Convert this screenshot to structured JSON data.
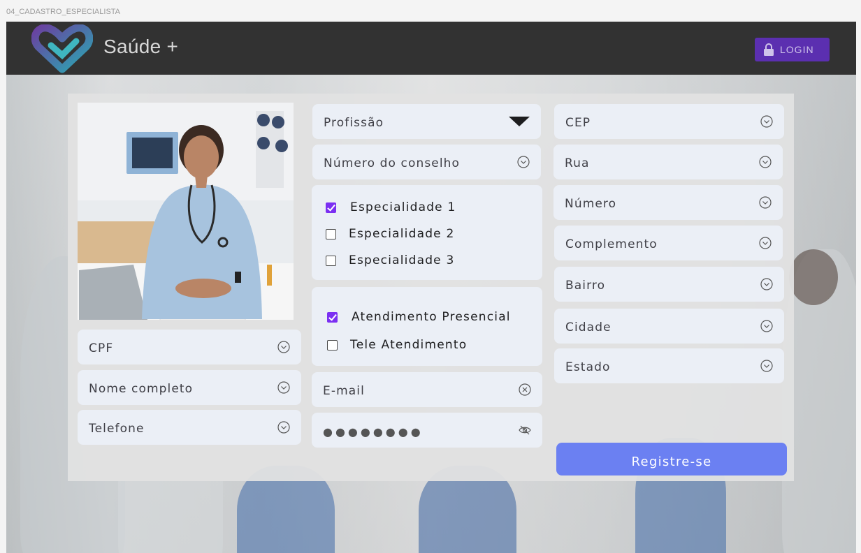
{
  "frame_label": "04_CADASTRO_ESPECIALISTA",
  "header": {
    "brand": "Saúde +",
    "login_label": "LOGIN"
  },
  "colors": {
    "topbar": "#323232",
    "accent_purple": "#5b2fb0",
    "checkbox_checked": "#7b2ff2",
    "register_button": "#6b80f2",
    "field_bg": "#ebeff6"
  },
  "left_fields": [
    {
      "label": "CPF",
      "icon": "chevron-circle-icon"
    },
    {
      "label": "Nome completo",
      "icon": "chevron-circle-icon"
    },
    {
      "label": "Telefone",
      "icon": "chevron-circle-icon"
    }
  ],
  "middle": {
    "profession": {
      "label": "Profissão",
      "icon": "dropdown-triangle-icon"
    },
    "council_number": {
      "label": "Número do conselho",
      "icon": "chevron-circle-icon"
    },
    "specialties": [
      {
        "label": "Especialidade 1",
        "checked": true
      },
      {
        "label": "Especialidade 2",
        "checked": false
      },
      {
        "label": "Especialidade 3",
        "checked": false
      }
    ],
    "attendance": [
      {
        "label": "Atendimento Presencial",
        "checked": true
      },
      {
        "label": "Tele Atendimento",
        "checked": false
      }
    ],
    "email": {
      "label": "E-mail",
      "icon": "clear-circle-icon"
    },
    "password": {
      "value": "●●●●●●●●",
      "icon": "eye-off-icon"
    }
  },
  "right_fields": [
    {
      "label": "CEP",
      "icon": "chevron-circle-icon"
    },
    {
      "label": "Rua",
      "icon": "chevron-circle-icon"
    },
    {
      "label": "Número",
      "icon": "chevron-circle-icon"
    },
    {
      "label": "Complemento",
      "icon": "chevron-circle-icon"
    },
    {
      "label": "Bairro",
      "icon": "chevron-circle-icon"
    },
    {
      "label": "Cidade",
      "icon": "chevron-circle-icon"
    },
    {
      "label": "Estado",
      "icon": "chevron-circle-icon"
    }
  ],
  "register_label": "Registre-se"
}
